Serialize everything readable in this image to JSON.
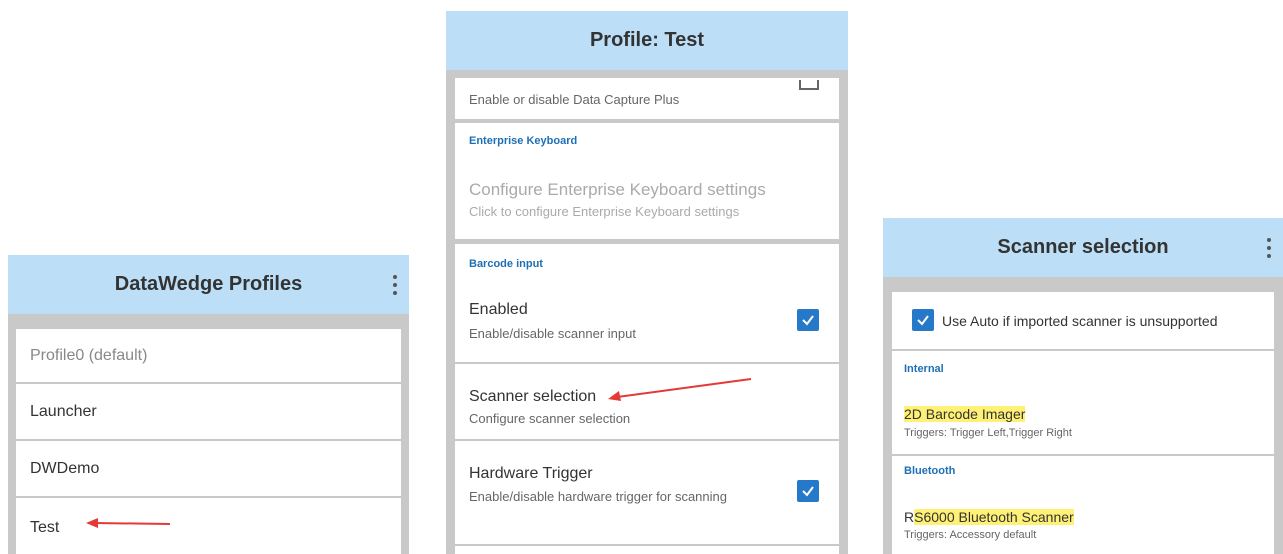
{
  "profiles_screen": {
    "title": "DataWedge Profiles",
    "items": [
      "Profile0 (default)",
      "Launcher",
      "DWDemo",
      "Test"
    ]
  },
  "profile_screen": {
    "title": "Profile: Test",
    "dcp_text": "Enable or disable Data Capture Plus",
    "ek_header": "Enterprise Keyboard",
    "ek_title": "Configure Enterprise Keyboard settings",
    "ek_sub": "Click to configure Enterprise Keyboard settings",
    "barcode_header": "Barcode input",
    "enabled_title": "Enabled",
    "enabled_sub": "Enable/disable scanner input",
    "scanner_title": "Scanner selection",
    "scanner_sub": "Configure scanner selection",
    "trigger_title": "Hardware Trigger",
    "trigger_sub": "Enable/disable hardware trigger for scanning"
  },
  "scanner_screen": {
    "title": "Scanner selection",
    "auto_label": "Use Auto if imported scanner is unsupported",
    "internal_header": "Internal",
    "internal_name": "2D Barcode Imager",
    "internal_triggers": "Triggers: Trigger Left,Trigger Right",
    "bt_header": "Bluetooth",
    "bt_name_prefix": "R",
    "bt_name_hl": "S6000 Bluetooth Scanner",
    "bt_triggers": "Triggers: Accessory default"
  },
  "colors": {
    "appbar": "#bcdff7",
    "accent": "#2678c9",
    "section": "#1e6fb5",
    "highlight": "#fff176",
    "arrow": "#e53935"
  },
  "icons": [
    "kebab-menu-icon",
    "checkbox-checked-icon",
    "red-arrow-icon"
  ]
}
